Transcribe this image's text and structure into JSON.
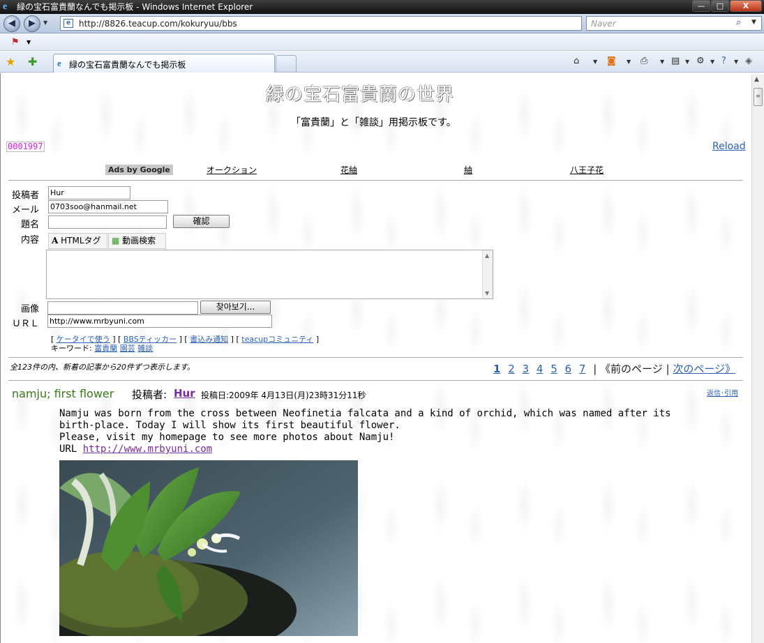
{
  "window": {
    "title": "緑の宝石富貴蘭なんでも掲示板 - Windows Internet Explorer",
    "min": "—",
    "max": "□",
    "close": "X"
  },
  "address": {
    "url": "http://8826.teacup.com/kokuryuu/bbs",
    "search_placeholder": "Naver"
  },
  "tab": {
    "label": "緑の宝石富貴蘭なんでも掲示板"
  },
  "page": {
    "title": "緑の宝石富貴蘭の世界",
    "subtitle": "「富貴蘭」と「雑談」用掲示板です。",
    "counter": "0001997",
    "reload": "Reload",
    "ads_label": "Ads by Google",
    "ads": [
      "オークション",
      "花紬",
      "紬",
      "八王子花"
    ]
  },
  "form": {
    "name_label": "投稿者",
    "name_value": "Hur",
    "mail_label": "メール",
    "mail_value": "0703soo@hanmail.net",
    "subject_label": "題名",
    "subject_value": "",
    "confirm_button": "確認",
    "content_label": "内容",
    "tool_html": "HTMLタグ",
    "tool_video": "動画検索",
    "image_label": "画像",
    "browse_button": "찾아보기...",
    "url_label": "ＵＲＬ",
    "url_value": "http://www.mrbyuni.com",
    "links": [
      "ケータイで使う",
      "BBSティッカー",
      "書込み通知",
      "teacupコミュニティ"
    ],
    "keyword_label": "キーワード:",
    "keywords": [
      "富貴蘭",
      "園芸",
      "雑談"
    ]
  },
  "listing": {
    "summary": "全123件の内、新着の記事から20件ずつ表示します。",
    "pages": [
      "1",
      "2",
      "3",
      "4",
      "5",
      "6",
      "7"
    ],
    "prev": "《前のページ",
    "next": "次のページ》"
  },
  "post": {
    "title": "namju; first flower",
    "byline_label": "投稿者:",
    "author": "Hur",
    "date": "投稿日:2009年 4月13日(月)23時31分11秒",
    "reply": "返信･引用",
    "lines": [
      "Namju was born from the cross between Neofinetia falcata and a kind of orchid, which was named after its",
      "birth-place. Today I will show its first beautiful flower.",
      "Please, visit my homepage to see more photos about Namju!"
    ],
    "url_prefix": "URL",
    "url": "http://www.mrbyuni.com"
  }
}
